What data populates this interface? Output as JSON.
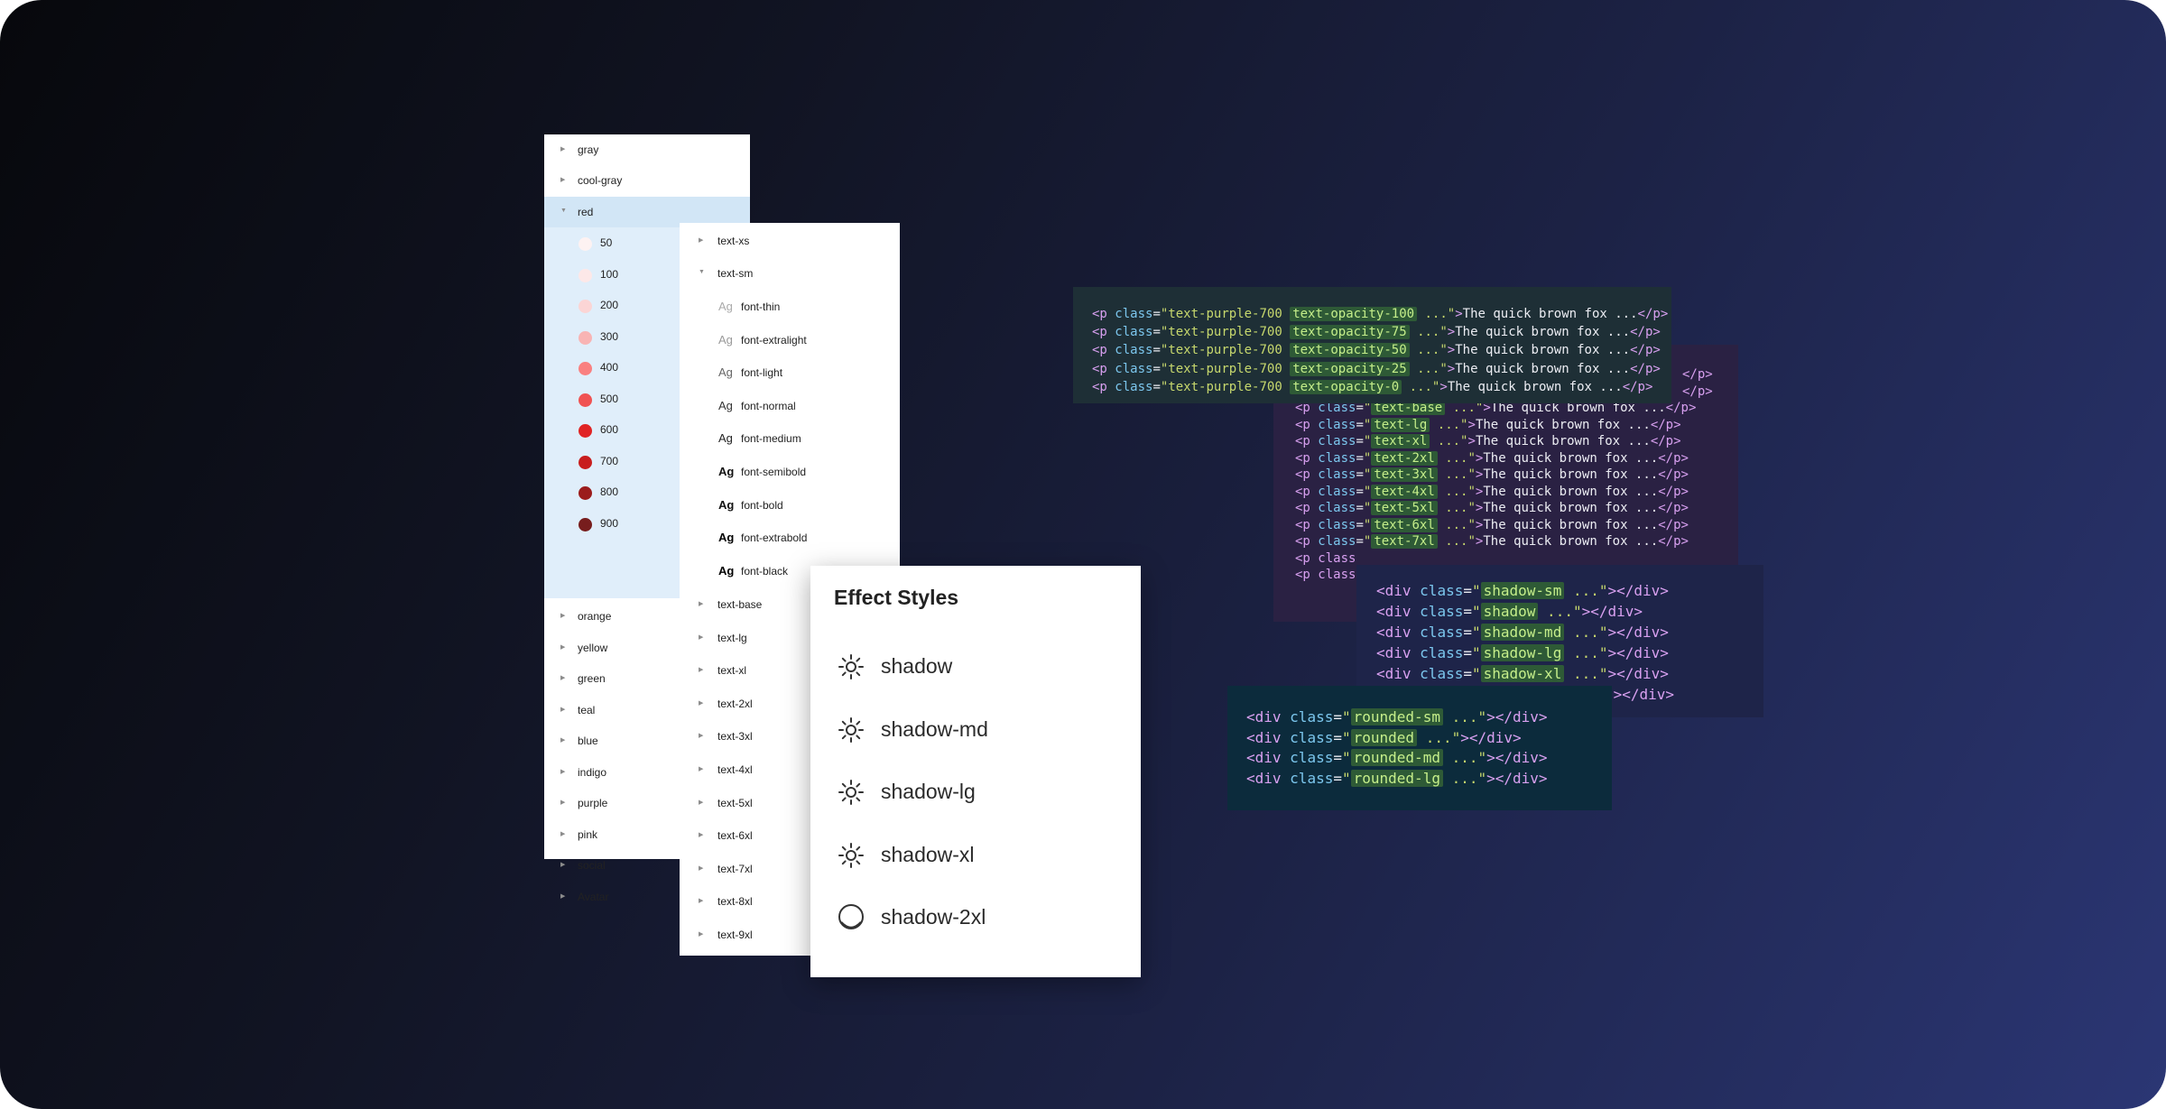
{
  "color_panel": {
    "groups_top": [
      {
        "name": "gray"
      },
      {
        "name": "cool-gray"
      }
    ],
    "expanded_group": {
      "name": "red"
    },
    "shades": [
      {
        "label": "50",
        "color": "#fdf2f2"
      },
      {
        "label": "100",
        "color": "#fde8e8"
      },
      {
        "label": "200",
        "color": "#fbd5d5"
      },
      {
        "label": "300",
        "color": "#f8b4b4"
      },
      {
        "label": "400",
        "color": "#f98080"
      },
      {
        "label": "500",
        "color": "#f05252"
      },
      {
        "label": "600",
        "color": "#e02424"
      },
      {
        "label": "700",
        "color": "#c81e1e"
      },
      {
        "label": "800",
        "color": "#9b1c1c"
      },
      {
        "label": "900",
        "color": "#771d1d"
      }
    ],
    "groups_bottom": [
      {
        "name": "orange"
      },
      {
        "name": "yellow"
      },
      {
        "name": "green"
      },
      {
        "name": "teal"
      },
      {
        "name": "blue"
      },
      {
        "name": "indigo"
      },
      {
        "name": "purple"
      },
      {
        "name": "pink"
      },
      {
        "name": "social"
      },
      {
        "name": "Avatar"
      }
    ]
  },
  "type_panel": {
    "first": {
      "name": "text-xs"
    },
    "expanded": {
      "name": "text-sm"
    },
    "weights": [
      {
        "ag": "Ag",
        "name": "font-thin",
        "weight": 100,
        "color": "#aaaaaa"
      },
      {
        "ag": "Ag",
        "name": "font-extralight",
        "weight": 200,
        "color": "#999999"
      },
      {
        "ag": "Ag",
        "name": "font-light",
        "weight": 300,
        "color": "#666666"
      },
      {
        "ag": "Ag",
        "name": "font-normal",
        "weight": 400,
        "color": "#333333"
      },
      {
        "ag": "Ag",
        "name": "font-medium",
        "weight": 500,
        "color": "#222222"
      },
      {
        "ag": "Ag",
        "name": "font-semibold",
        "weight": 600,
        "color": "#111111"
      },
      {
        "ag": "Ag",
        "name": "font-bold",
        "weight": 700,
        "color": "#111111"
      },
      {
        "ag": "Ag",
        "name": "font-extrabold",
        "weight": 800,
        "color": "#000000"
      },
      {
        "ag": "Ag",
        "name": "font-black",
        "weight": 900,
        "color": "#000000"
      }
    ],
    "sizes": [
      {
        "name": "text-base"
      },
      {
        "name": "text-lg"
      },
      {
        "name": "text-xl"
      },
      {
        "name": "text-2xl"
      },
      {
        "name": "text-3xl"
      },
      {
        "name": "text-4xl"
      },
      {
        "name": "text-5xl"
      },
      {
        "name": "text-6xl"
      },
      {
        "name": "text-7xl"
      },
      {
        "name": "text-8xl"
      },
      {
        "name": "text-9xl"
      }
    ]
  },
  "effect_panel": {
    "title": "Effect Styles",
    "items": [
      {
        "name": "shadow",
        "icon": "sun-icon"
      },
      {
        "name": "shadow-md",
        "icon": "sun-icon"
      },
      {
        "name": "shadow-lg",
        "icon": "sun-icon"
      },
      {
        "name": "shadow-xl",
        "icon": "sun-icon"
      },
      {
        "name": "shadow-2xl",
        "icon": "shadow-circle-icon"
      }
    ]
  },
  "code_opacity": {
    "tag": "p",
    "base_class": "text-purple-700",
    "rows": [
      {
        "cls": "text-opacity-100",
        "content": "The quick brown fox ..."
      },
      {
        "cls": "text-opacity-75",
        "content": "The quick brown fox ..."
      },
      {
        "cls": "text-opacity-50",
        "content": "The quick brown fox ..."
      },
      {
        "cls": "text-opacity-25",
        "content": "The quick brown fox ..."
      },
      {
        "cls": "text-opacity-0",
        "content": "The quick brown fox ..."
      }
    ]
  },
  "code_sizes": {
    "partial_top": [
      "</p>",
      "</p>"
    ],
    "rows": [
      {
        "cls": "text-base",
        "content": "The quick brown fox ..."
      },
      {
        "cls": "text-lg",
        "content": "The quick brown fox ..."
      },
      {
        "cls": "text-xl",
        "content": "The quick brown fox ..."
      },
      {
        "cls": "text-2xl",
        "content": "The quick brown fox ..."
      },
      {
        "cls": "text-3xl",
        "content": "The quick brown fox ..."
      },
      {
        "cls": "text-4xl",
        "content": "The quick brown fox ..."
      },
      {
        "cls": "text-5xl",
        "content": "The quick brown fox ..."
      },
      {
        "cls": "text-6xl",
        "content": "The quick brown fox ..."
      },
      {
        "cls": "text-7xl",
        "content": "The quick brown fox ..."
      }
    ],
    "partial_bottom": [
      "<p class",
      "<p class"
    ]
  },
  "code_shadows": {
    "rows": [
      {
        "cls": "shadow-sm"
      },
      {
        "cls": "shadow"
      },
      {
        "cls": "shadow-md"
      },
      {
        "cls": "shadow-lg"
      },
      {
        "cls": "shadow-xl"
      }
    ],
    "trailing": "\"></div>"
  },
  "code_rounded": {
    "rows": [
      {
        "cls": "rounded-sm"
      },
      {
        "cls": "rounded"
      },
      {
        "cls": "rounded-md"
      },
      {
        "cls": "rounded-lg"
      }
    ]
  }
}
